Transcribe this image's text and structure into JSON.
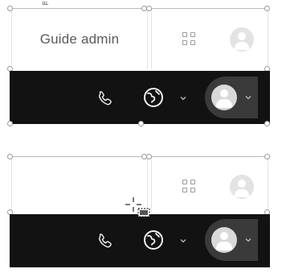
{
  "top_panel": {
    "admin_label": "Guide admin",
    "top_fragment": "ᴸᴸᴸ",
    "icons": {
      "apps": "grid-icon",
      "avatar_light": "avatar-icon",
      "phone": "phone-icon",
      "globe": "globe-icon",
      "globe_chevron": "chevron-down-icon",
      "avatar_dark": "avatar-icon",
      "avatar_chevron": "chevron-down-icon"
    }
  },
  "bottom_panel": {
    "admin_label": "",
    "icons": {
      "apps": "grid-icon",
      "avatar_light": "avatar-icon",
      "phone": "phone-icon",
      "globe": "globe-icon",
      "globe_chevron": "chevron-down-icon",
      "avatar_dark": "avatar-icon",
      "avatar_chevron": "chevron-down-icon",
      "cursor": "move-cursor-icon"
    }
  },
  "colors": {
    "toolbar_bg": "#121212",
    "pill_bg": "#3a3a3a",
    "text": "#5a5a5a",
    "icon_light": "#9a9a9a"
  }
}
